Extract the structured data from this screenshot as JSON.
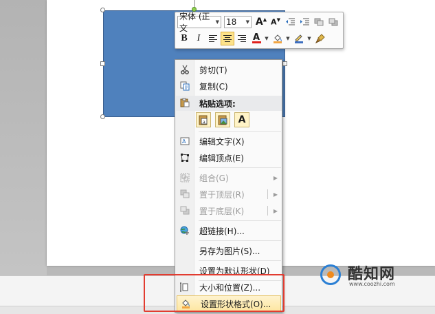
{
  "mini_toolbar": {
    "font_name": "宋体 (正文",
    "font_size": "18",
    "bold": "B",
    "italic": "I",
    "font_color_glyph": "A",
    "grow_glyph": "A",
    "shrink_glyph": "A"
  },
  "context_menu": {
    "cut": "剪切(T)",
    "copy": "复制(C)",
    "paste_options_label": "粘贴选项:",
    "paste_text_option": "A",
    "edit_text": "编辑文字(X)",
    "edit_points": "编辑顶点(E)",
    "group": "组合(G)",
    "bring_to_front": "置于顶层(R)",
    "send_to_back": "置于底层(K)",
    "hyperlink": "超链接(H)...",
    "save_as_picture": "另存为图片(S)...",
    "set_default_shape": "设置为默认形状(D)",
    "size_and_position": "大小和位置(Z)...",
    "format_shape": "设置形状格式(O)..."
  },
  "watermark": {
    "brand": "酷知网",
    "url": "www.coozhi.com"
  },
  "colors": {
    "shape_fill": "#4f81bd",
    "highlight_box": "#e23c30",
    "hover_fill": "#fde6a0",
    "active_button": "#fde28a"
  }
}
